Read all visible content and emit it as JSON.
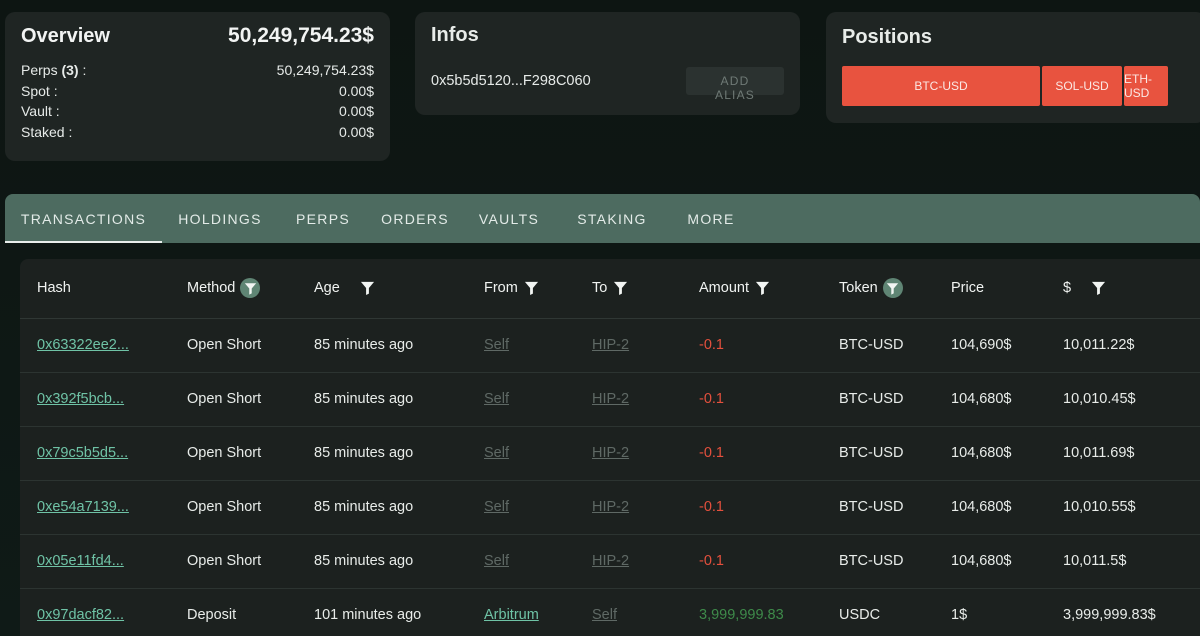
{
  "overview": {
    "title": "Overview",
    "total": "50,249,754.23$",
    "rows": [
      {
        "label": "Perps",
        "count": "(3)",
        "suffix": " :",
        "value": "50,249,754.23$"
      },
      {
        "label": "Spot :",
        "count": "",
        "suffix": "",
        "value": "0.00$"
      },
      {
        "label": "Vault :",
        "count": "",
        "suffix": "",
        "value": "0.00$"
      },
      {
        "label": "Staked :",
        "count": "",
        "suffix": "",
        "value": "0.00$"
      }
    ]
  },
  "infos": {
    "title": "Infos",
    "address": "0x5b5d5120...F298C060",
    "alias_button": "ADD ALIAS"
  },
  "positions": {
    "title": "Positions",
    "items": [
      {
        "label": "BTC-USD",
        "share": 0.6
      },
      {
        "label": "SOL-USD",
        "share": 0.2
      },
      {
        "label": "ETH-USD",
        "share": 0.2
      }
    ],
    "bar_color": "#e8533f"
  },
  "tabs": [
    "TRANSACTIONS",
    "HOLDINGS",
    "PERPS",
    "ORDERS",
    "VAULTS",
    "STAKING",
    "MORE"
  ],
  "active_tab": "TRANSACTIONS",
  "table": {
    "columns": [
      {
        "label": "Hash",
        "filter": "none"
      },
      {
        "label": "Method",
        "filter": "circle"
      },
      {
        "label": "Age",
        "filter": "plain"
      },
      {
        "label": "From",
        "filter": "plain"
      },
      {
        "label": "To",
        "filter": "plain"
      },
      {
        "label": "Amount",
        "filter": "plain"
      },
      {
        "label": "Token",
        "filter": "circle"
      },
      {
        "label": "Price",
        "filter": "none"
      },
      {
        "label": "$",
        "filter": "plain"
      }
    ],
    "rows": [
      {
        "hash": "0x63322ee2...",
        "method": "Open Short",
        "age": "85 minutes ago",
        "from": "Self",
        "to": "HIP-2",
        "amount": "-0.1",
        "token": "BTC-USD",
        "price": "104,690$",
        "usd": "10,011.22$"
      },
      {
        "hash": "0x392f5bcb...",
        "method": "Open Short",
        "age": "85 minutes ago",
        "from": "Self",
        "to": "HIP-2",
        "amount": "-0.1",
        "token": "BTC-USD",
        "price": "104,680$",
        "usd": "10,010.45$"
      },
      {
        "hash": "0x79c5b5d5...",
        "method": "Open Short",
        "age": "85 minutes ago",
        "from": "Self",
        "to": "HIP-2",
        "amount": "-0.1",
        "token": "BTC-USD",
        "price": "104,680$",
        "usd": "10,011.69$"
      },
      {
        "hash": "0xe54a7139...",
        "method": "Open Short",
        "age": "85 minutes ago",
        "from": "Self",
        "to": "HIP-2",
        "amount": "-0.1",
        "token": "BTC-USD",
        "price": "104,680$",
        "usd": "10,010.55$"
      },
      {
        "hash": "0x05e11fd4...",
        "method": "Open Short",
        "age": "85 minutes ago",
        "from": "Self",
        "to": "HIP-2",
        "amount": "-0.1",
        "token": "BTC-USD",
        "price": "104,680$",
        "usd": "10,011.5$"
      },
      {
        "hash": "0x97dacf82...",
        "method": "Deposit",
        "age": "101 minutes ago",
        "from": "Arbitrum",
        "to": "Self",
        "amount": "3,999,999.83",
        "token": "USDC",
        "price": "1$",
        "usd": "3,999,999.83$"
      }
    ]
  },
  "colors": {
    "negative": "#e4503d",
    "positive": "#3e8a4a",
    "link": "#6fc3a6",
    "tab_bar": "#4d6b60"
  }
}
